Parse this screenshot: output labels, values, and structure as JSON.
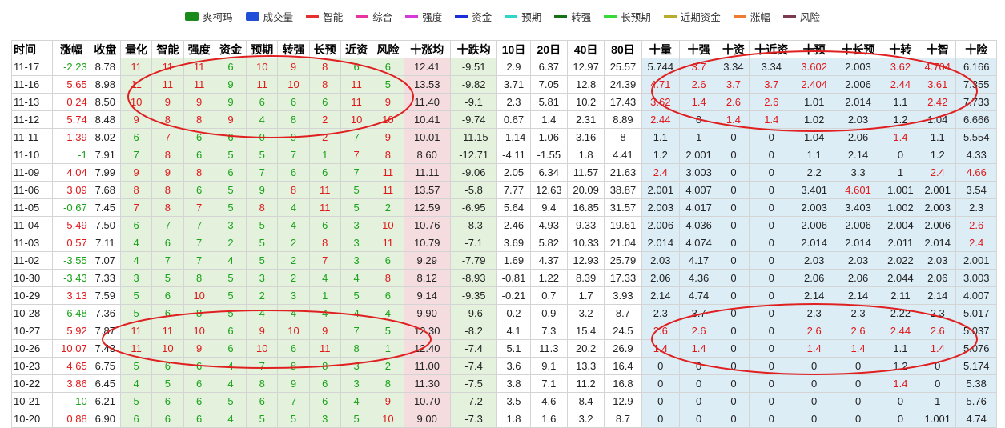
{
  "legend": [
    {
      "label": "爽柯玛",
      "kind": "box",
      "color": "#1a8a1a"
    },
    {
      "label": "成交量",
      "kind": "box",
      "color": "#1f4fd6"
    },
    {
      "label": "智能",
      "kind": "line",
      "color": "#e53030"
    },
    {
      "label": "综合",
      "kind": "line",
      "color": "#e833a0"
    },
    {
      "label": "强度",
      "kind": "line",
      "color": "#d53ad8"
    },
    {
      "label": "资金",
      "kind": "line",
      "color": "#1b2fd8"
    },
    {
      "label": "预期",
      "kind": "line",
      "color": "#2fd6c8"
    },
    {
      "label": "转强",
      "kind": "line",
      "color": "#167016"
    },
    {
      "label": "长预期",
      "kind": "line",
      "color": "#38d838"
    },
    {
      "label": "近期资金",
      "kind": "line",
      "color": "#b8ac2a"
    },
    {
      "label": "涨幅",
      "kind": "line",
      "color": "#f07a30"
    },
    {
      "label": "风险",
      "kind": "line",
      "color": "#7a3a52"
    }
  ],
  "columns": [
    "时间",
    "涨幅",
    "收盘",
    "量化",
    "智能",
    "强度",
    "资金",
    "预期",
    "转强",
    "长预",
    "近资",
    "风险",
    "十涨均",
    "十跌均",
    "10日",
    "20日",
    "40日",
    "80日",
    "十量",
    "十强",
    "十资",
    "十近资",
    "十预",
    "十长预",
    "十转",
    "十智",
    "十险"
  ],
  "colors": {
    "red": "#e0191b",
    "green": "#1aa31a",
    "bg_green": "#e3f1dd",
    "bg_pink": "#f5dcdf",
    "bg_blue": "#dcedf6",
    "circle": "#e02020"
  },
  "rows": [
    [
      "11-17",
      "-2.23",
      "8.78",
      "11",
      "11",
      "11",
      "6",
      "10",
      "9",
      "8",
      "6",
      "6",
      "12.41",
      "-9.51",
      "2.9",
      "6.37",
      "12.97",
      "25.57",
      "5.744",
      "3.7",
      "3.34",
      "3.34",
      "3.602",
      "2.003",
      "3.62",
      "4.704",
      "6.166"
    ],
    [
      "11-16",
      "5.65",
      "8.98",
      "11",
      "11",
      "11",
      "9",
      "11",
      "10",
      "8",
      "11",
      "5",
      "13.53",
      "-9.82",
      "3.71",
      "7.05",
      "12.8",
      "24.39",
      "4.71",
      "2.6",
      "3.7",
      "3.7",
      "2.404",
      "2.006",
      "2.44",
      "3.61",
      "7.355"
    ],
    [
      "11-13",
      "0.24",
      "8.50",
      "10",
      "9",
      "9",
      "9",
      "6",
      "6",
      "6",
      "11",
      "9",
      "11.40",
      "-9.1",
      "2.3",
      "5.81",
      "10.2",
      "17.43",
      "3.62",
      "1.4",
      "2.6",
      "2.6",
      "1.01",
      "2.014",
      "1.1",
      "2.42",
      "7.733"
    ],
    [
      "11-12",
      "5.74",
      "8.48",
      "9",
      "8",
      "8",
      "9",
      "4",
      "8",
      "2",
      "10",
      "10",
      "10.41",
      "-9.74",
      "0.67",
      "1.4",
      "2.31",
      "8.89",
      "2.44",
      "0",
      "1.4",
      "1.4",
      "1.02",
      "2.03",
      "1.2",
      "1.04",
      "6.666"
    ],
    [
      "11-11",
      "1.39",
      "8.02",
      "6",
      "7",
      "6",
      "6",
      "0",
      "9",
      "2",
      "7",
      "9",
      "10.01",
      "-11.15",
      "-1.14",
      "1.06",
      "3.16",
      "8",
      "1.1",
      "1",
      "0",
      "0",
      "1.04",
      "2.06",
      "1.4",
      "1.1",
      "5.554"
    ],
    [
      "11-10",
      "-1",
      "7.91",
      "7",
      "8",
      "6",
      "5",
      "5",
      "7",
      "1",
      "7",
      "8",
      "8.60",
      "-12.71",
      "-4.11",
      "-1.55",
      "1.8",
      "4.41",
      "1.2",
      "2.001",
      "0",
      "0",
      "1.1",
      "2.14",
      "0",
      "1.2",
      "4.33"
    ],
    [
      "11-09",
      "4.04",
      "7.99",
      "9",
      "9",
      "8",
      "6",
      "7",
      "6",
      "6",
      "7",
      "11",
      "11.11",
      "-9.06",
      "2.05",
      "6.34",
      "11.57",
      "21.63",
      "2.4",
      "3.003",
      "0",
      "0",
      "2.2",
      "3.3",
      "1",
      "2.4",
      "4.66"
    ],
    [
      "11-06",
      "3.09",
      "7.68",
      "8",
      "8",
      "6",
      "5",
      "9",
      "8",
      "11",
      "5",
      "11",
      "13.57",
      "-5.8",
      "7.77",
      "12.63",
      "20.09",
      "38.87",
      "2.001",
      "4.007",
      "0",
      "0",
      "3.401",
      "4.601",
      "1.001",
      "2.001",
      "3.54"
    ],
    [
      "11-05",
      "-0.67",
      "7.45",
      "7",
      "8",
      "7",
      "5",
      "8",
      "4",
      "11",
      "5",
      "2",
      "12.59",
      "-6.95",
      "5.64",
      "9.4",
      "16.85",
      "31.57",
      "2.003",
      "4.017",
      "0",
      "0",
      "2.003",
      "3.403",
      "1.002",
      "2.003",
      "2.3"
    ],
    [
      "11-04",
      "5.49",
      "7.50",
      "6",
      "7",
      "7",
      "3",
      "5",
      "4",
      "6",
      "3",
      "10",
      "10.76",
      "-8.3",
      "2.46",
      "4.93",
      "9.33",
      "19.61",
      "2.006",
      "4.036",
      "0",
      "0",
      "2.006",
      "2.006",
      "2.004",
      "2.006",
      "2.6"
    ],
    [
      "11-03",
      "0.57",
      "7.11",
      "4",
      "6",
      "7",
      "2",
      "5",
      "2",
      "8",
      "3",
      "11",
      "10.79",
      "-7.1",
      "3.69",
      "5.82",
      "10.33",
      "21.04",
      "2.014",
      "4.074",
      "0",
      "0",
      "2.014",
      "2.014",
      "2.011",
      "2.014",
      "2.4"
    ],
    [
      "11-02",
      "-3.55",
      "7.07",
      "4",
      "7",
      "7",
      "4",
      "5",
      "2",
      "7",
      "3",
      "6",
      "9.29",
      "-7.79",
      "1.69",
      "4.37",
      "12.93",
      "25.79",
      "2.03",
      "4.17",
      "0",
      "0",
      "2.03",
      "2.03",
      "2.022",
      "2.03",
      "2.001"
    ],
    [
      "10-30",
      "-3.43",
      "7.33",
      "3",
      "5",
      "8",
      "5",
      "3",
      "2",
      "4",
      "4",
      "8",
      "8.12",
      "-8.93",
      "-0.81",
      "1.22",
      "8.39",
      "17.33",
      "2.06",
      "4.36",
      "0",
      "0",
      "2.06",
      "2.06",
      "2.044",
      "2.06",
      "3.003"
    ],
    [
      "10-29",
      "3.13",
      "7.59",
      "5",
      "6",
      "10",
      "5",
      "2",
      "3",
      "1",
      "5",
      "6",
      "9.14",
      "-9.35",
      "-0.21",
      "0.7",
      "1.7",
      "3.93",
      "2.14",
      "4.74",
      "0",
      "0",
      "2.14",
      "2.14",
      "2.11",
      "2.14",
      "4.007"
    ],
    [
      "10-28",
      "-6.48",
      "7.36",
      "5",
      "6",
      "8",
      "5",
      "4",
      "4",
      "4",
      "4",
      "4",
      "9.90",
      "-9.6",
      "0.2",
      "0.9",
      "3.2",
      "8.7",
      "2.3",
      "3.7",
      "0",
      "0",
      "2.3",
      "2.3",
      "2.22",
      "2.3",
      "5.017"
    ],
    [
      "10-27",
      "5.92",
      "7.87",
      "11",
      "11",
      "10",
      "6",
      "9",
      "10",
      "9",
      "7",
      "5",
      "12.30",
      "-8.2",
      "4.1",
      "7.3",
      "15.4",
      "24.5",
      "2.6",
      "2.6",
      "0",
      "0",
      "2.6",
      "2.6",
      "2.44",
      "2.6",
      "5.037"
    ],
    [
      "10-26",
      "10.07",
      "7.43",
      "11",
      "10",
      "9",
      "6",
      "10",
      "6",
      "11",
      "8",
      "1",
      "12.40",
      "-7.4",
      "5.1",
      "11.3",
      "20.2",
      "26.9",
      "1.4",
      "1.4",
      "0",
      "0",
      "1.4",
      "1.4",
      "1.1",
      "1.4",
      "5.076"
    ],
    [
      "10-23",
      "4.65",
      "6.75",
      "5",
      "6",
      "6",
      "4",
      "7",
      "8",
      "8",
      "3",
      "2",
      "11.00",
      "-7.4",
      "3.6",
      "9.1",
      "13.3",
      "16.4",
      "0",
      "0",
      "0",
      "0",
      "0",
      "0",
      "1.2",
      "0",
      "5.174"
    ],
    [
      "10-22",
      "3.86",
      "6.45",
      "4",
      "5",
      "6",
      "4",
      "8",
      "9",
      "6",
      "3",
      "8",
      "11.30",
      "-7.5",
      "3.8",
      "7.1",
      "11.2",
      "16.8",
      "0",
      "0",
      "0",
      "0",
      "0",
      "0",
      "1.4",
      "0",
      "5.38"
    ],
    [
      "10-21",
      "-10",
      "6.21",
      "5",
      "6",
      "6",
      "5",
      "6",
      "7",
      "6",
      "4",
      "9",
      "10.70",
      "-7.2",
      "3.5",
      "4.6",
      "8.4",
      "12.9",
      "0",
      "0",
      "0",
      "0",
      "0",
      "0",
      "0",
      "1",
      "5.76"
    ],
    [
      "10-20",
      "0.88",
      "6.90",
      "6",
      "6",
      "6",
      "4",
      "5",
      "5",
      "3",
      "5",
      "10",
      "9.00",
      "-7.3",
      "1.8",
      "1.6",
      "3.2",
      "8.7",
      "0",
      "0",
      "0",
      "0",
      "0",
      "0",
      "0",
      "1.001",
      "4.74"
    ]
  ],
  "red_cells": [
    [
      0,
      3
    ],
    [
      0,
      4
    ],
    [
      0,
      5
    ],
    [
      0,
      7
    ],
    [
      0,
      8
    ],
    [
      0,
      9
    ],
    [
      0,
      19
    ],
    [
      0,
      22
    ],
    [
      0,
      24
    ],
    [
      0,
      25
    ],
    [
      1,
      3
    ],
    [
      1,
      4
    ],
    [
      1,
      5
    ],
    [
      1,
      7
    ],
    [
      1,
      8
    ],
    [
      1,
      9
    ],
    [
      1,
      10
    ],
    [
      1,
      18
    ],
    [
      1,
      19
    ],
    [
      1,
      20
    ],
    [
      1,
      21
    ],
    [
      1,
      22
    ],
    [
      1,
      24
    ],
    [
      1,
      25
    ],
    [
      2,
      3
    ],
    [
      2,
      4
    ],
    [
      2,
      5
    ],
    [
      2,
      10
    ],
    [
      2,
      11
    ],
    [
      2,
      18
    ],
    [
      2,
      19
    ],
    [
      2,
      20
    ],
    [
      2,
      21
    ],
    [
      2,
      25
    ],
    [
      3,
      3
    ],
    [
      3,
      4
    ],
    [
      3,
      5
    ],
    [
      3,
      6
    ],
    [
      3,
      9
    ],
    [
      3,
      10
    ],
    [
      3,
      11
    ],
    [
      3,
      18
    ],
    [
      3,
      20
    ],
    [
      3,
      21
    ],
    [
      4,
      4
    ],
    [
      4,
      9
    ],
    [
      4,
      11
    ],
    [
      4,
      24
    ],
    [
      5,
      4
    ],
    [
      5,
      10
    ],
    [
      5,
      11
    ],
    [
      6,
      3
    ],
    [
      6,
      4
    ],
    [
      6,
      5
    ],
    [
      6,
      11
    ],
    [
      6,
      18
    ],
    [
      6,
      25
    ],
    [
      6,
      26
    ],
    [
      7,
      3
    ],
    [
      7,
      4
    ],
    [
      7,
      8
    ],
    [
      7,
      9
    ],
    [
      7,
      11
    ],
    [
      7,
      23
    ],
    [
      8,
      3
    ],
    [
      8,
      4
    ],
    [
      8,
      5
    ],
    [
      8,
      7
    ],
    [
      8,
      9
    ],
    [
      9,
      11
    ],
    [
      9,
      26
    ],
    [
      10,
      9
    ],
    [
      10,
      11
    ],
    [
      10,
      26
    ],
    [
      11,
      9
    ],
    [
      12,
      11
    ],
    [
      13,
      5
    ],
    [
      15,
      3
    ],
    [
      15,
      4
    ],
    [
      15,
      5
    ],
    [
      15,
      7
    ],
    [
      15,
      8
    ],
    [
      15,
      9
    ],
    [
      15,
      18
    ],
    [
      15,
      19
    ],
    [
      15,
      22
    ],
    [
      15,
      23
    ],
    [
      15,
      24
    ],
    [
      15,
      25
    ],
    [
      16,
      3
    ],
    [
      16,
      4
    ],
    [
      16,
      5
    ],
    [
      16,
      7
    ],
    [
      16,
      9
    ],
    [
      16,
      18
    ],
    [
      16,
      19
    ],
    [
      16,
      22
    ],
    [
      16,
      23
    ],
    [
      16,
      25
    ],
    [
      18,
      24
    ],
    [
      19,
      11
    ],
    [
      20,
      11
    ]
  ]
}
